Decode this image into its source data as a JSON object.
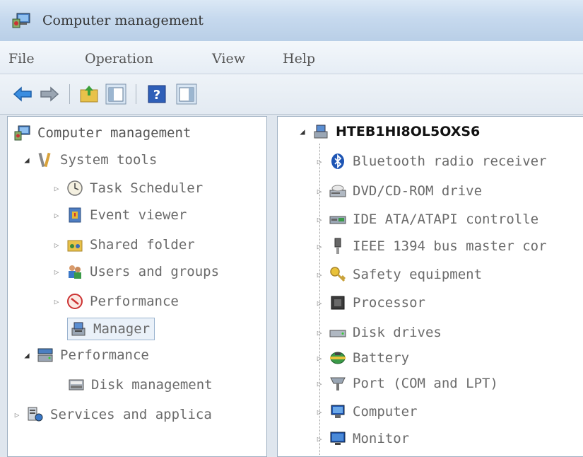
{
  "window": {
    "title": "Computer management"
  },
  "menu": [
    "File",
    "Operation",
    "View",
    "Help"
  ],
  "toolbar": {
    "buttons": [
      "back-arrow-icon",
      "forward-arrow-icon",
      "up-folder-icon",
      "show-hide-tree-icon",
      "help-icon",
      "action-pane-icon"
    ]
  },
  "tree": {
    "root": "Computer management",
    "system_tools": "System tools",
    "task_scheduler": "Task Scheduler",
    "event_viewer": "Event viewer",
    "shared_folder": "Shared folder",
    "users_groups": "Users and groups",
    "performance": "Performance",
    "manager": "Manager",
    "storage": "Performance",
    "disk_management": "Disk management",
    "services": "Services and applica"
  },
  "devices": {
    "host": "HTEB1HI8OL5OXS6",
    "items": [
      "Bluetooth radio receiver",
      "DVD/CD-ROM drive",
      "IDE ATA/ATAPI controlle",
      "IEEE 1394 bus master cor",
      "Safety equipment",
      "Processor",
      "Disk drives",
      "Battery",
      "Port (COM and LPT)",
      "Computer",
      "Monitor"
    ]
  },
  "colors": {
    "accent": "#3a78c8",
    "title_bar": "#c6d9ee"
  }
}
